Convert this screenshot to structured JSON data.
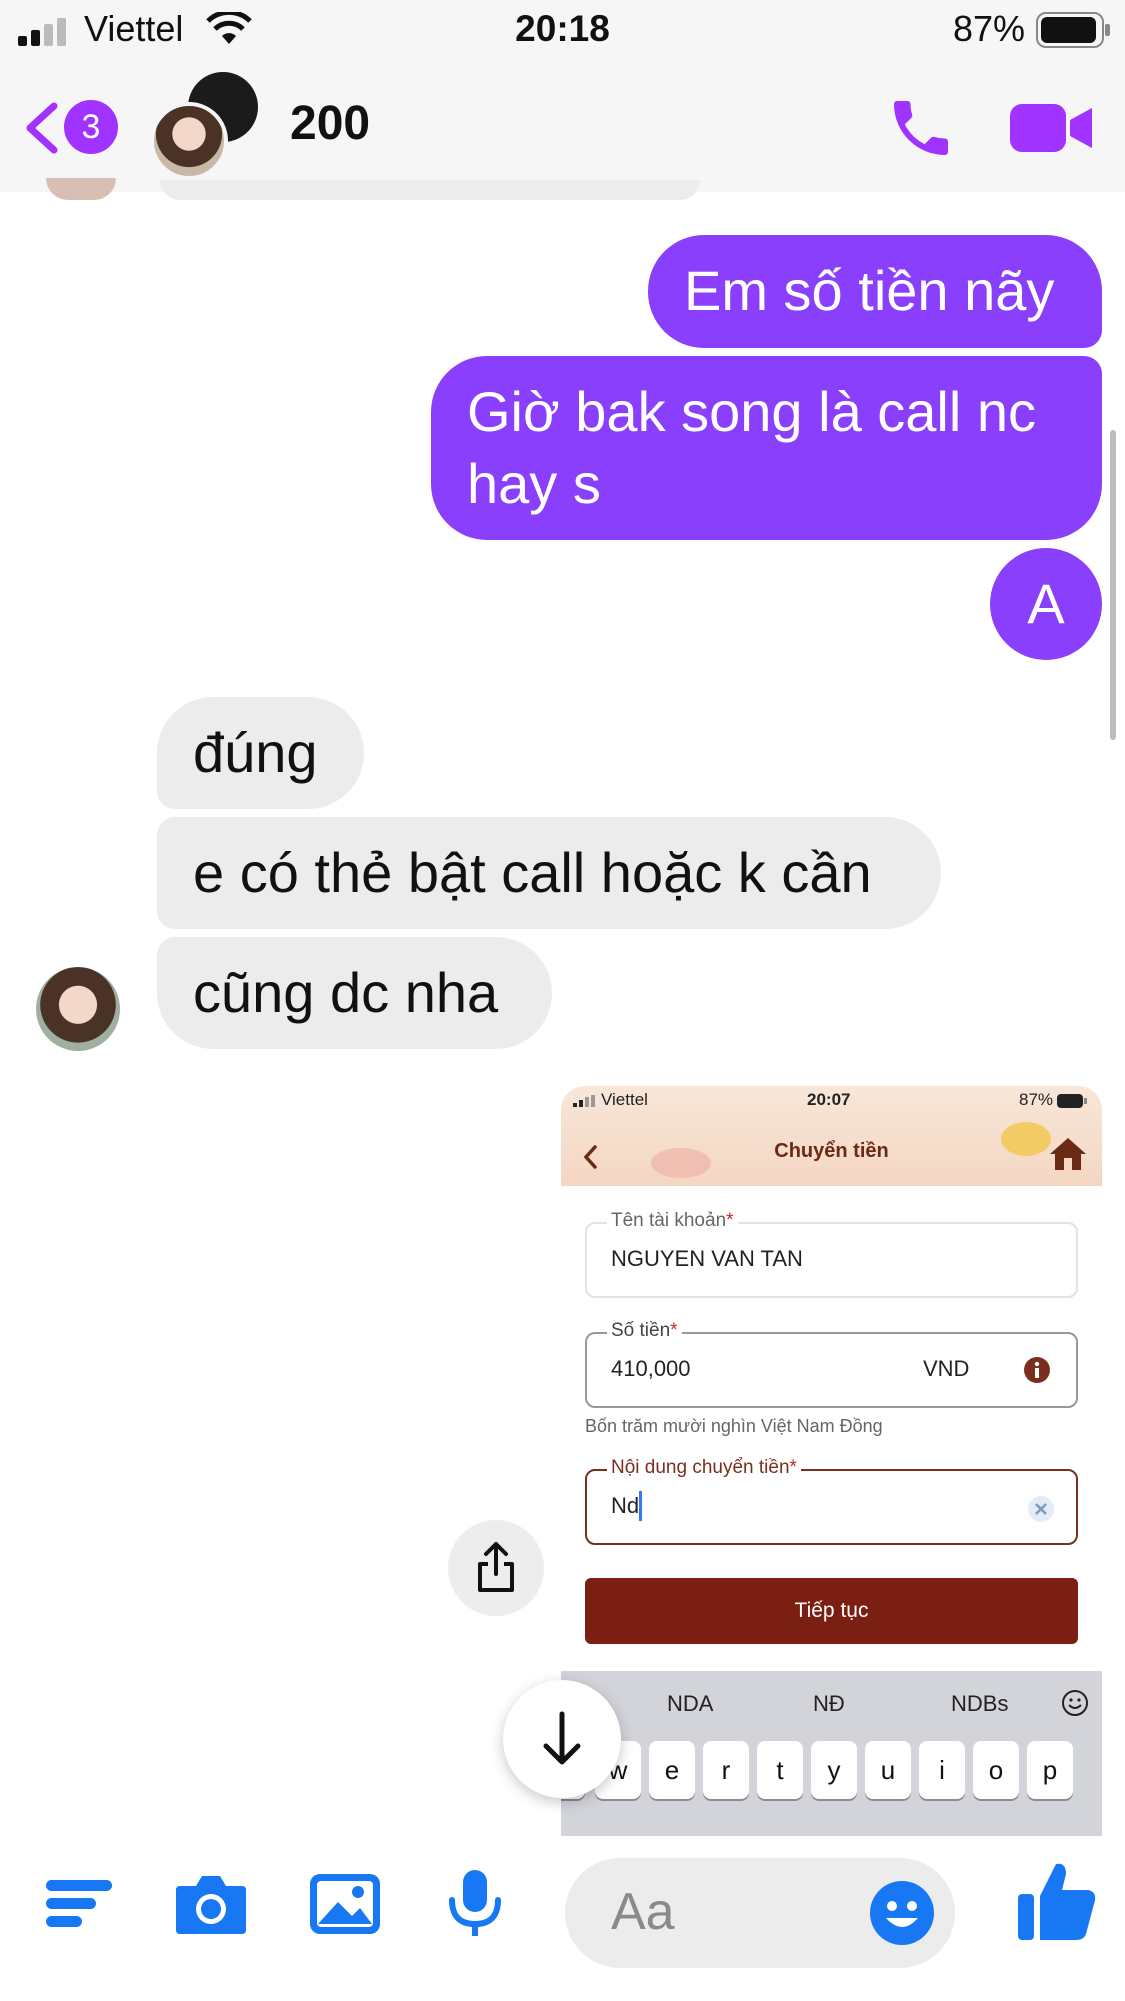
{
  "status_bar": {
    "carrier": "Viettel",
    "time": "20:18",
    "battery": "87%"
  },
  "header": {
    "back_badge": "3",
    "title": "200"
  },
  "messages": {
    "outgoing_1": "Em số tiền nãy",
    "outgoing_2_line1": "Giờ bak song là call nc",
    "outgoing_2_line2": "hay s",
    "outgoing_3": "A",
    "incoming_1": "đúng",
    "incoming_2": "e có thẻ bật call hoặc k cần",
    "incoming_3": "cũng dc nha"
  },
  "attached_screenshot": {
    "status": {
      "carrier": "Viettel",
      "time": "20:07",
      "battery": "87%"
    },
    "title": "Chuyển tiền",
    "account_name_label": "Tên tài khoản",
    "account_name_value": "NGUYEN VAN TAN",
    "amount_label": "Số tiền",
    "amount_value": "410,000",
    "currency": "VND",
    "amount_in_words": "Bốn trăm mười nghìn Việt Nam Đồng",
    "content_label": "Nội dung chuyển tiền",
    "content_value": "Nd",
    "required_mark": "*",
    "continue_button": "Tiếp tục",
    "suggestions": [
      "NDA",
      "NĐ",
      "NDBs"
    ],
    "keys": [
      "w",
      "e",
      "r",
      "t",
      "y",
      "u",
      "i",
      "o",
      "p"
    ]
  },
  "composer": {
    "placeholder": "Aa"
  },
  "colors": {
    "accent": "#8a3ffc",
    "incoming_bubble": "#ececec",
    "bank_primary": "#7a2f1e",
    "tool_blue": "#1877f2"
  }
}
